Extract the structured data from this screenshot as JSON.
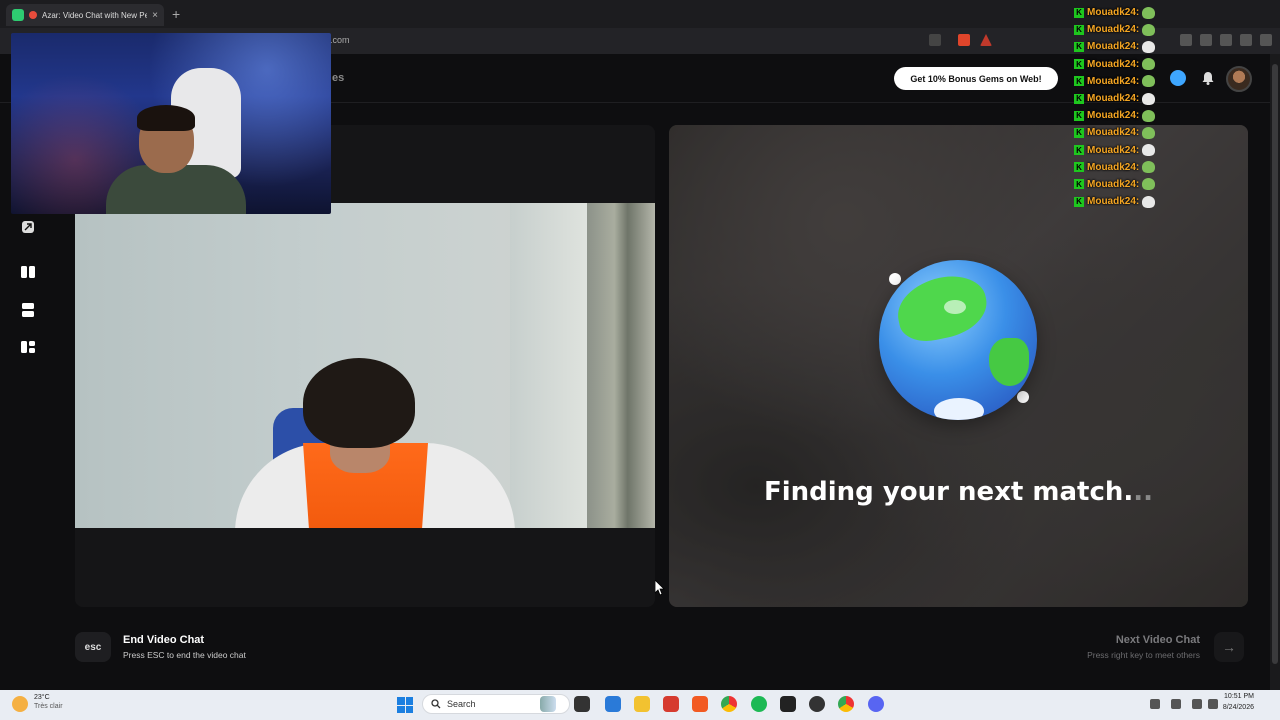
{
  "browser": {
    "tab_title": "Azar: Video Chat with New Pe",
    "new_tab": "+",
    "close": "×",
    "url": ".com"
  },
  "header": {
    "nav_partial": "es",
    "promo_label": "Get 10% Bonus Gems on Web!"
  },
  "match": {
    "status_text": "Finding your next match.",
    "status_dots": ".."
  },
  "footer": {
    "esc_key": "esc",
    "end_title": "End Video Chat",
    "end_sub": "Press ESC to end the video chat",
    "next_title": "Next Video Chat",
    "next_sub": "Press right key to meet others",
    "next_arrow": "→"
  },
  "chat": {
    "badge": "K",
    "messages": [
      {
        "user": "Mouadk24:"
      },
      {
        "user": "Mouadk24:"
      },
      {
        "user": "Mouadk24:"
      },
      {
        "user": "Mouadk24:"
      },
      {
        "user": "Mouadk24:"
      },
      {
        "user": "Mouadk24:"
      },
      {
        "user": "Mouadk24:"
      },
      {
        "user": "Mouadk24:"
      },
      {
        "user": "Mouadk24:"
      },
      {
        "user": "Mouadk24:"
      },
      {
        "user": "Mouadk24:"
      },
      {
        "user": "Mouadk24:"
      }
    ]
  },
  "taskbar": {
    "weather_temp": "23°C",
    "weather_desc": "Très clair",
    "search_placeholder": "Search",
    "time": "10:51 PM",
    "date": "8/24/2026"
  },
  "colors": {
    "accent_green": "#2ecc71",
    "chat_name": "#f5a623",
    "promo_bg": "#ffffff"
  }
}
